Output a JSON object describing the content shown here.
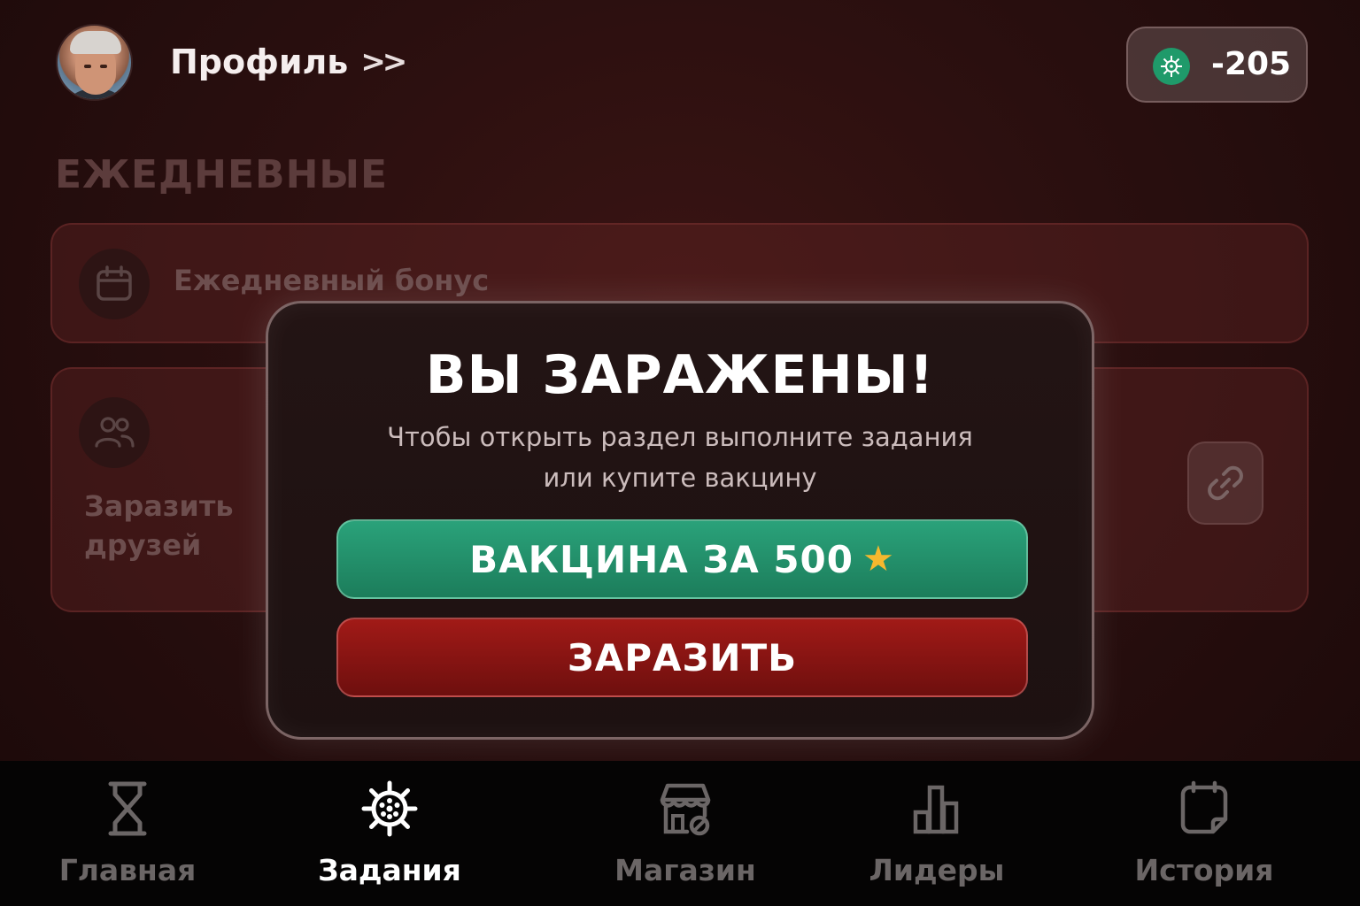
{
  "header": {
    "profile_label": "Профиль",
    "profile_chevron": ">>",
    "balance": "-205",
    "balance_icon": "virus-coin-icon"
  },
  "daily": {
    "section_title": "ЕЖЕДНЕВНЫЕ",
    "daily_bonus_label": "Ежедневный бонус",
    "infect_friends_label": "Заразить друзей"
  },
  "modal": {
    "title": "ВЫ ЗАРАЖЕНЫ!",
    "subtitle_line1": "Чтобы открыть раздел выполните задания",
    "subtitle_line2": "или купите вакцину",
    "vaccine_button": "ВАКЦИНА ЗА 500",
    "vaccine_star": "★",
    "infect_button": "ЗАРАЗИТЬ"
  },
  "nav": {
    "home": "Главная",
    "tasks": "Задания",
    "shop": "Магазин",
    "leaders": "Лидеры",
    "history": "История",
    "active": "tasks"
  },
  "colors": {
    "vaccine_green": "#1f8a63",
    "infect_red": "#8d1513",
    "star": "#f5b82e",
    "coin_green": "#1f9a6a"
  }
}
